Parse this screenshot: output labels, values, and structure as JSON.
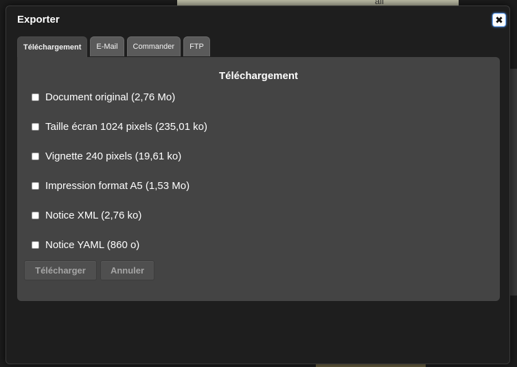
{
  "background": {
    "partial_text": "all"
  },
  "dialog": {
    "title": "Exporter",
    "close_icon": "close-icon"
  },
  "tabs": [
    {
      "label": "Téléchargement",
      "active": true
    },
    {
      "label": "E-Mail",
      "active": false
    },
    {
      "label": "Commander",
      "active": false
    },
    {
      "label": "FTP",
      "active": false
    }
  ],
  "panel": {
    "title": "Téléchargement",
    "options": [
      {
        "label": "Document original (2,76 Mo)",
        "checked": false
      },
      {
        "label": "Taille écran 1024 pixels (235,01 ko)",
        "checked": false
      },
      {
        "label": "Vignette 240 pixels (19,61 ko)",
        "checked": false
      },
      {
        "label": "Impression format A5 (1,53 Mo)",
        "checked": false
      },
      {
        "label": "Notice XML (2,76 ko)",
        "checked": false
      },
      {
        "label": "Notice YAML (860 o)",
        "checked": false
      }
    ],
    "buttons": {
      "download_label": "Télécharger",
      "cancel_label": "Annuler"
    }
  },
  "colors": {
    "dialog_bg": "#1e1e1e",
    "panel_bg": "#444444",
    "tab_bg": "#5a5a5a",
    "close_focus": "#4d9bff"
  }
}
